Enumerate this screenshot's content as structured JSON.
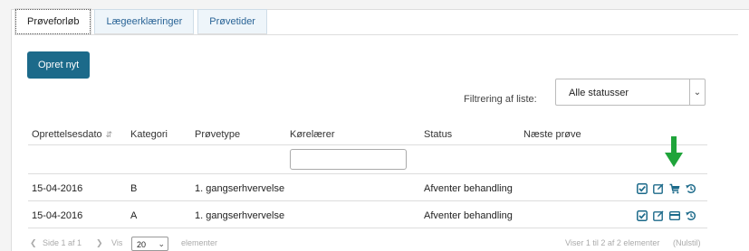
{
  "tabs": [
    {
      "label": "Prøveforløb",
      "active": true
    },
    {
      "label": "Lægeerklæringer",
      "active": false
    },
    {
      "label": "Prøvetider",
      "active": false
    }
  ],
  "toolbar": {
    "new_label": "Opret nyt"
  },
  "filter": {
    "label": "Filtrering af liste:",
    "selected": "Alle statusser"
  },
  "table": {
    "headers": [
      "Oprettelsesdato",
      "Kategori",
      "Prøvetype",
      "Kørelærer",
      "Status",
      "Næste prøve"
    ],
    "rows": [
      {
        "date": "15-04-2016",
        "category": "B",
        "type": "1. gangserhvervelse",
        "instructor": "",
        "status": "Afventer behandling",
        "next": "",
        "actions": [
          "check-square-icon",
          "edit-icon",
          "cart-icon",
          "history-icon"
        ]
      },
      {
        "date": "15-04-2016",
        "category": "A",
        "type": "1. gangserhvervelse",
        "instructor": "",
        "status": "Afventer behandling",
        "next": "",
        "actions": [
          "check-square-icon",
          "edit-icon",
          "card-icon",
          "history-icon"
        ]
      }
    ]
  },
  "pager": {
    "page_text": "Side 1 af 1",
    "show_label": "Vis",
    "page_size": "20",
    "elements_label": "elementer",
    "summary": "Viser 1 til 2 af 2 elementer",
    "reset": "(Nulstil)"
  },
  "colors": {
    "accent": "#1c6a8a",
    "arrow": "#1fa43a"
  }
}
